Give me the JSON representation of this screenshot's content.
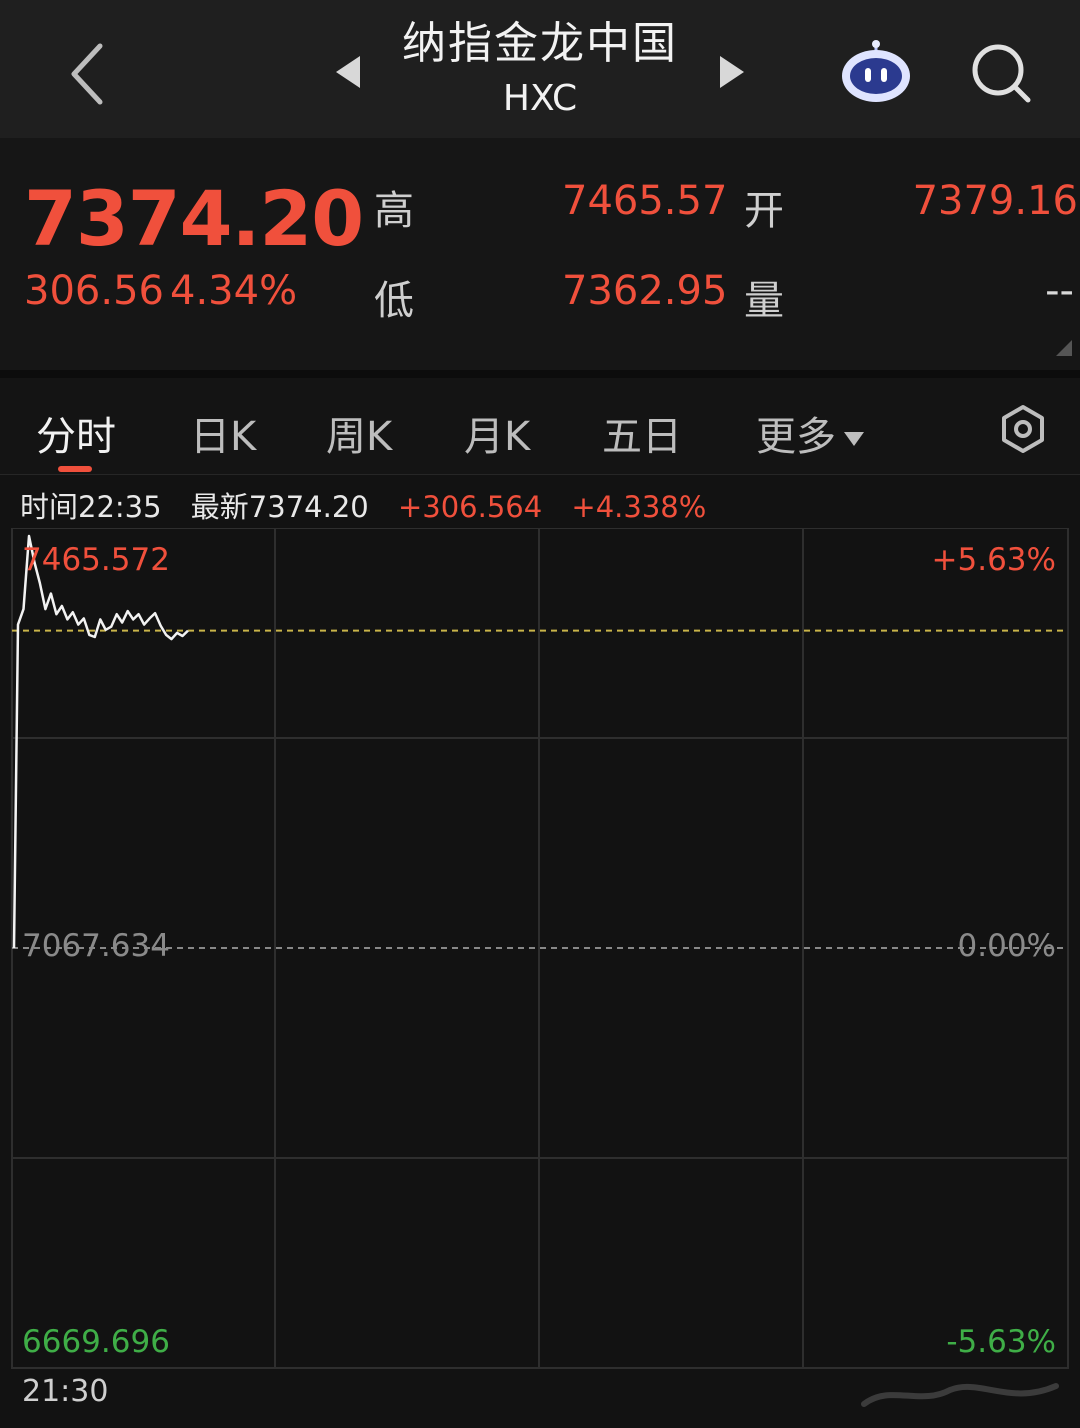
{
  "header": {
    "title": "纳指金龙中国",
    "subtitle": "HXC"
  },
  "quote": {
    "price": "7374.20",
    "change": "306.56",
    "change_pct": "4.34%",
    "high_label": "高",
    "high": "7465.57",
    "open_label": "开",
    "open": "7379.16",
    "low_label": "低",
    "low": "7362.95",
    "volume_label": "量",
    "volume": "--"
  },
  "tabs": [
    {
      "label": "分时",
      "active": true
    },
    {
      "label": "日K"
    },
    {
      "label": "周K"
    },
    {
      "label": "月K"
    },
    {
      "label": "五日"
    },
    {
      "label": "更多"
    }
  ],
  "info_bar": {
    "time": "时间22:35",
    "latest": "最新7374.20",
    "change": "+306.564",
    "change_pct": "+4.338%"
  },
  "chart_data": {
    "type": "line",
    "y_max_label": "7465.572",
    "y_mid_label": "7067.634",
    "y_min_label": "6669.696",
    "pct_max_label": "+5.63%",
    "pct_mid_label": "0.00%",
    "pct_min_label": "-5.63%",
    "ylim": [
      6669.696,
      7465.572
    ],
    "reference_price": 7067.634,
    "current_price": 7374.2,
    "x_start_label": "21:30",
    "series": [
      {
        "values": [
          7067.634,
          7380,
          7395,
          7465.572,
          7440,
          7420,
          7395,
          7410,
          7390,
          7398,
          7385,
          7392,
          7380,
          7386,
          7370,
          7368,
          7385,
          7375,
          7378,
          7390,
          7382,
          7393,
          7385,
          7390,
          7380,
          7386,
          7391,
          7379,
          7370,
          7366,
          7372,
          7369,
          7374.2
        ]
      }
    ],
    "colors": {
      "line": "#f2f2f2",
      "up": "#f0503c",
      "down": "#3fae47",
      "ref": "#888888",
      "current": "#c9b44a",
      "grid": "#2e2e2e"
    }
  }
}
